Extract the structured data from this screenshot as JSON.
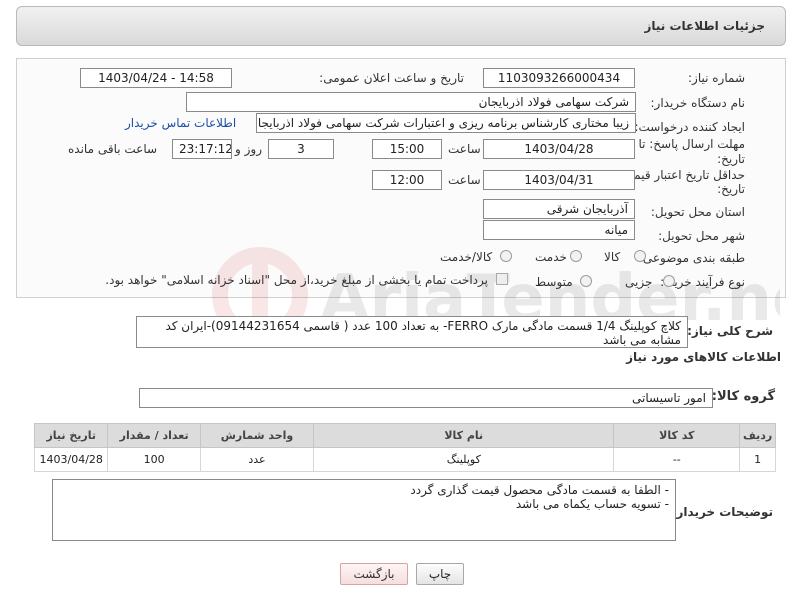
{
  "header": {
    "title": "جزئیات اطلاعات نیاز"
  },
  "form": {
    "need_number_label": "شماره نیاز:",
    "need_number": "1103093266000434",
    "announce_label": "تاریخ و ساعت اعلان عمومی:",
    "announce_value": "1403/04/24 - 14:58",
    "buyer_org_label": "نام دستگاه خریدار:",
    "buyer_org": "شرکت سهامی فولاد اذربایجان",
    "creator_label": "ایجاد کننده درخواست:",
    "creator": "زیبا مختاری کارشناس برنامه ریزی و اعتبارات شرکت سهامی فولاد اذربایجان",
    "contact_link": "اطلاعات تماس خریدار",
    "deadline_label_1": "مهلت ارسال پاسخ: تا",
    "deadline_label_2": "تاریخ:",
    "deadline_date": "1403/04/28",
    "time_label": "ساعت",
    "deadline_time": "15:00",
    "days_value": "3",
    "days_label": "روز و",
    "remaining_time": "23:17:12",
    "remaining_label": "ساعت باقی مانده",
    "validity_label_1": "حداقل تاریخ اعتبار قیمت: تا",
    "validity_label_2": "تاریخ:",
    "validity_date": "1403/04/31",
    "validity_time": "12:00",
    "province_label": "استان محل تحویل:",
    "province": "آذربایجان شرقی",
    "city_label": "شهر محل تحویل:",
    "city": "میانه",
    "category_label": "طبقه بندی موضوعی:",
    "category_options": [
      "کالا",
      "خدمت",
      "کالا/خدمت"
    ],
    "purchase_type_label": "نوع فرآیند خرید :",
    "purchase_options": [
      "جزیی",
      "متوسط"
    ],
    "payment_note": "پرداخت تمام یا بخشی از مبلغ خرید،از محل \"اسناد خزانه اسلامی\" خواهد بود."
  },
  "description": {
    "label": "شرح کلی نیاز:",
    "text": "کلاچ کوپلینگ 1/4 قسمت مادگی مارک FERRO- به تعداد 100 عدد   ( قاسمی 09144231654)-ایران کد مشابه می باشد"
  },
  "items_section": {
    "title": "اطلاعات کالاهای مورد نیاز",
    "group_label": "گروه کالا:",
    "group_value": "امور تاسیساتی",
    "columns": [
      "ردیف",
      "کد کالا",
      "نام کالا",
      "واحد شمارش",
      "تعداد / مقدار",
      "تاریخ نیاز"
    ],
    "rows": [
      {
        "row": "1",
        "code": "--",
        "name": "کوپلینگ",
        "unit": "عدد",
        "qty": "100",
        "date": "1403/04/28"
      }
    ]
  },
  "buyer_notes": {
    "label": "توضیحات خریدار:",
    "lines": [
      "- الطفا به قسمت مادگی محصول قیمت گذاری گردد",
      "- تسویه حساب یکماه می باشد"
    ]
  },
  "buttons": {
    "print": "چاپ",
    "back": "بازگشت"
  },
  "watermark": "AriaTender.neT"
}
